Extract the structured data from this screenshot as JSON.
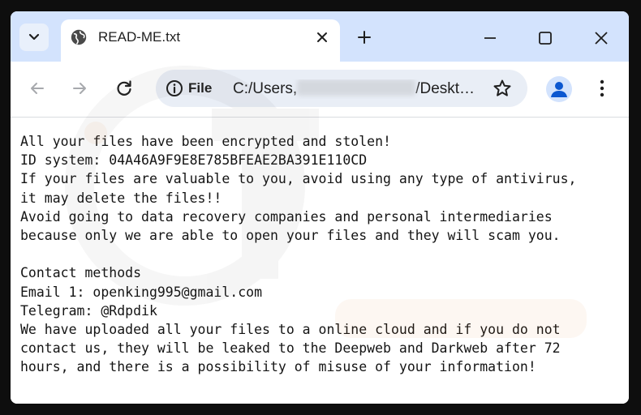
{
  "tab": {
    "title": "READ-ME.txt"
  },
  "address_bar": {
    "chip_label": "File",
    "url_prefix": "C:/Users,",
    "url_suffix": "/Deskt…"
  },
  "document": {
    "lines": [
      "All your files have been encrypted and stolen!",
      "ID system: 04A46A9F9E8E785BFEAE2BA391E110CD",
      "If your files are valuable to you, avoid using any type of antivirus,",
      "it may delete the files!!",
      "Avoid going to data recovery companies and personal intermediaries",
      "because only we are able to open your files and they will scam you.",
      "",
      "Contact methods",
      "Email 1: openking995@gmail.com",
      "Telegram: @Rdpdik",
      "We have uploaded all your files to a online cloud and if you do not",
      "contact us, they will be leaked to the Deepweb and Darkweb after 72",
      "hours, and there is a possibility of misuse of your information!"
    ]
  },
  "icons": {
    "tab_search": "chevron-down-icon",
    "favicon": "globe-icon",
    "tab_close": "close-icon",
    "new_tab": "plus-icon",
    "minimize": "minimize-icon",
    "maximize": "maximize-icon",
    "window_close": "close-icon",
    "back": "arrow-left-icon",
    "forward": "arrow-right-icon",
    "reload": "reload-icon",
    "site_info": "info-icon",
    "bookmark": "star-icon",
    "profile": "person-icon",
    "menu": "kebab-menu-icon"
  },
  "colors": {
    "tab_strip": "#d3e3fd",
    "omnibox": "#e9eef6",
    "page_bg": "#ffffff",
    "text": "#141414"
  }
}
